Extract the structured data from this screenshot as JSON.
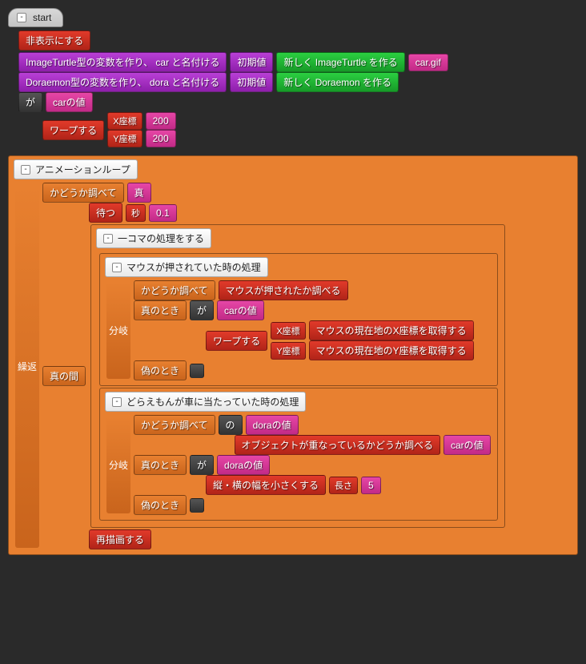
{
  "start": {
    "label": "start"
  },
  "hide": {
    "label": "非表示にする"
  },
  "var_car": {
    "decl": "ImageTurtle型の変数を作り、 car と名付ける",
    "init_label": "初期値",
    "new_expr": "新しく ImageTurtle を作る",
    "filename": "car.gif"
  },
  "var_dora": {
    "decl": "Doraemon型の変数を作り、 dora と名付ける",
    "init_label": "初期値",
    "new_expr": "新しく Doraemon を作る"
  },
  "target1": {
    "ga": "が",
    "car_value": "carの値",
    "warp": "ワープする",
    "x_label": "X座標",
    "y_label": "Y座標",
    "x": "200",
    "y": "200"
  },
  "loop": {
    "title": "アニメーションループ",
    "repeat_label": "繰返",
    "check_label": "かどうか調べて",
    "true_val": "真",
    "while_label": "真の間",
    "wait": "待つ",
    "sec_label": "秒",
    "sec_val": "0.1",
    "frame_title": "一コマの処理をする",
    "redraw": "再描画する"
  },
  "mouse": {
    "title": "マウスが押されていた時の処理",
    "check_label": "かどうか調べて",
    "cond": "マウスが押されたか調べる",
    "branch_label": "分岐",
    "true_label": "真のとき",
    "false_label": "偽のとき",
    "ga": "が",
    "car_value": "carの値",
    "warp": "ワープする",
    "x_label": "X座標",
    "y_label": "Y座標",
    "mouse_x": "マウスの現在地のX座標を取得する",
    "mouse_y": "マウスの現在地のY座標を取得する"
  },
  "collision": {
    "title": "どらえもんが車に当たっていた時の処理",
    "check_label": "かどうか調べて",
    "no_label": "の",
    "dora_value": "doraの値",
    "overlap": "オブジェクトが重なっているかどうか調べる",
    "car_value": "carの値",
    "branch_label": "分岐",
    "true_label": "真のとき",
    "false_label": "偽のとき",
    "ga": "が",
    "shrink": "縦・横の幅を小さくする",
    "len_label": "長さ",
    "len_val": "5"
  }
}
